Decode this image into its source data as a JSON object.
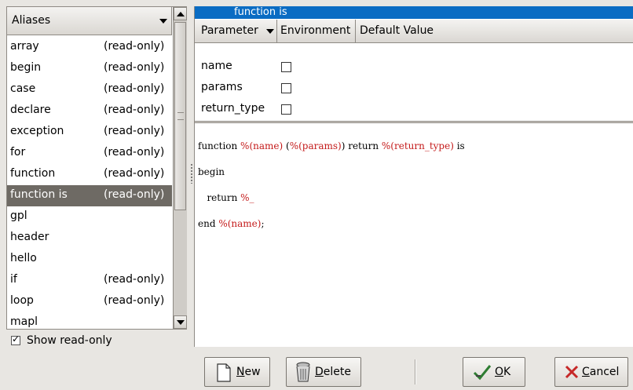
{
  "aliases": {
    "header": "Aliases",
    "items": [
      {
        "name": "array",
        "ro": "(read-only)"
      },
      {
        "name": "begin",
        "ro": "(read-only)"
      },
      {
        "name": "case",
        "ro": "(read-only)"
      },
      {
        "name": "declare",
        "ro": "(read-only)"
      },
      {
        "name": "exception",
        "ro": "(read-only)"
      },
      {
        "name": "for",
        "ro": "(read-only)"
      },
      {
        "name": "function",
        "ro": "(read-only)"
      },
      {
        "name": "function is",
        "ro": "(read-only)"
      },
      {
        "name": "gpl",
        "ro": ""
      },
      {
        "name": "header",
        "ro": ""
      },
      {
        "name": "hello",
        "ro": ""
      },
      {
        "name": "if",
        "ro": "(read-only)"
      },
      {
        "name": "loop",
        "ro": "(read-only)"
      },
      {
        "name": "mapl",
        "ro": ""
      }
    ],
    "selected": "function is"
  },
  "show_readonly": {
    "label": "Show read-only",
    "checked": true
  },
  "editor": {
    "title": "function is",
    "columns": {
      "parameter": "Parameter",
      "environment": "Environment",
      "default_value": "Default Value"
    },
    "params": [
      {
        "name": "name",
        "environment": false
      },
      {
        "name": "params",
        "environment": false
      },
      {
        "name": "return_type",
        "environment": false
      }
    ],
    "code": {
      "l1a": "function ",
      "l1b": "%(name)",
      "l1c": " (",
      "l1d": "%(params)",
      "l1e": ") return ",
      "l1f": "%(return_type)",
      "l1g": " is",
      "l2": "begin",
      "l3a": "   return ",
      "l3b": "%_",
      "l4a": "end ",
      "l4b": "%(name)",
      "l4c": ";"
    }
  },
  "buttons": {
    "new": {
      "mn": "N",
      "rest": "ew"
    },
    "delete": {
      "mn": "D",
      "rest": "elete"
    },
    "ok": {
      "mn": "O",
      "rest": "K"
    },
    "cancel": {
      "mn": "C",
      "rest": "ancel"
    }
  },
  "colors": {
    "accent": "#0a6cc3",
    "selected_row": "#6e6a64",
    "macro": "#c41b1b"
  }
}
